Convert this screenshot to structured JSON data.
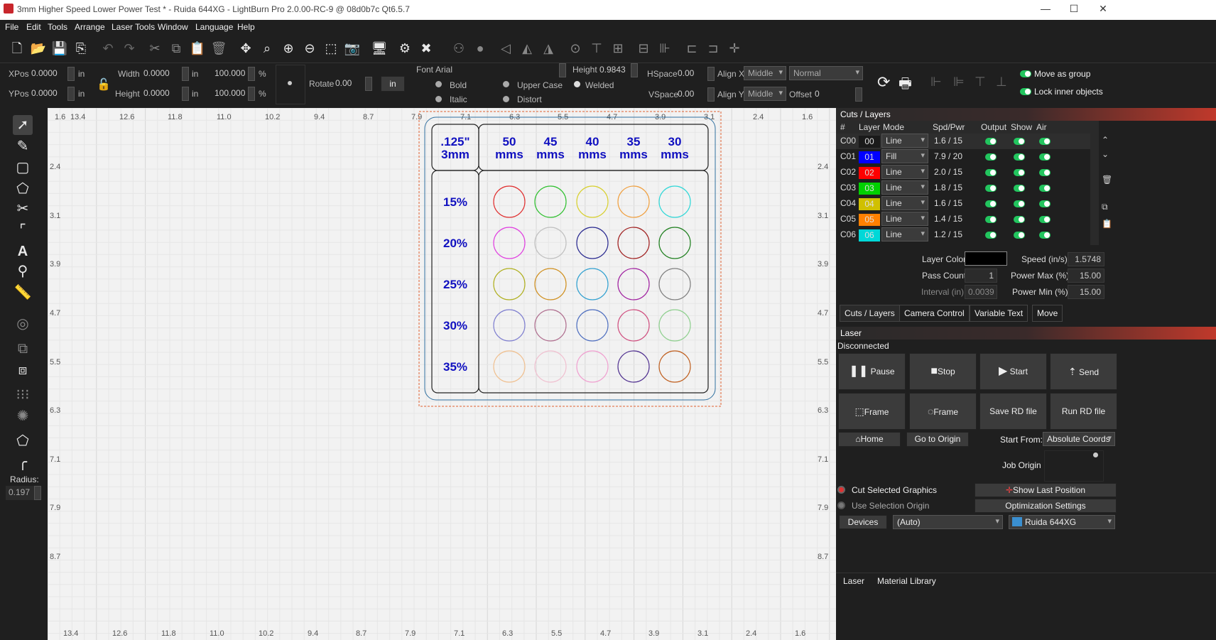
{
  "title": "3mm Higher Speed Lower Power Test * - Ruida 644XG - LightBurn Pro 2.0.00-RC-9 @ 08d0b7c Qt6.5.7",
  "menu": [
    "File",
    "Edit",
    "Tools",
    "Arrange",
    "Laser Tools",
    "Window",
    "Language",
    "Help"
  ],
  "props": {
    "xpos_label": "XPos",
    "xpos": "0.0000",
    "ypos_label": "YPos",
    "ypos": "0.0000",
    "unit_in": "in",
    "width_label": "Width",
    "width": "0.0000",
    "height_label": "Height",
    "height": "0.0000",
    "pct_w": "100.000",
    "pct_h": "100.000",
    "pct": "%",
    "rotate_label": "Rotate",
    "rotate": "0.00",
    "in_btn": "in",
    "font_label": "Font",
    "font": "Arial",
    "height_label2": "Height",
    "font_height": "0.9843",
    "hspace_label": "HSpace",
    "hspace": "0.00",
    "vspace_label": "VSpace",
    "vspace": "0.00",
    "alignx_label": "Align X",
    "alignx": "Middle",
    "aligny_label": "Align Y",
    "aligny": "Middle",
    "normal": "Normal",
    "offset_label": "Offset",
    "offset": "0",
    "bold": "Bold",
    "italic": "Italic",
    "upper_case": "Upper Case",
    "distort": "Distort",
    "welded": "Welded",
    "move_as_group": "Move as group",
    "lock_inner": "Lock inner objects"
  },
  "left": {
    "radius_label": "Radius:",
    "radius": "0.197"
  },
  "ruler": {
    "top": [
      "1.6",
      "13.4",
      "12.6",
      "11.8",
      "11.0",
      "10.2",
      "9.4",
      "8.7",
      "7.9",
      "7.1",
      "6.3",
      "5.5",
      "4.7",
      "3.9",
      "3.1",
      "2.4",
      "1.6"
    ],
    "bottom": [
      "13.4",
      "12.6",
      "11.8",
      "11.0",
      "10.2",
      "9.4",
      "8.7",
      "7.9",
      "7.1",
      "6.3",
      "5.5",
      "4.7",
      "3.9",
      "3.1",
      "2.4",
      "1.6"
    ],
    "left": [
      "2.4",
      "3.1",
      "3.9",
      "4.7",
      "5.5",
      "6.3",
      "7.1",
      "7.9",
      "8.7"
    ],
    "right": [
      "2.4",
      "3.1",
      "3.9",
      "4.7",
      "5.5",
      "6.3",
      "7.1",
      "7.9",
      "8.7"
    ]
  },
  "design": {
    "corner": [
      ".125\"",
      "3mm"
    ],
    "speeds": [
      [
        "50",
        "mms"
      ],
      [
        "45",
        "mms"
      ],
      [
        "40",
        "mms"
      ],
      [
        "35",
        "mms"
      ],
      [
        "30",
        "mms"
      ]
    ],
    "powers": [
      "15%",
      "20%",
      "25%",
      "30%",
      "35%"
    ],
    "circle_colors": [
      [
        "#e03030",
        "#30c030",
        "#d8d030",
        "#f0a040",
        "#30d8d8"
      ],
      [
        "#e040e0",
        "#c0c0c0",
        "#2a2a90",
        "#a02020",
        "#208020"
      ],
      [
        "#b0b020",
        "#d09020",
        "#30a0d0",
        "#a020a0",
        "#808080"
      ],
      [
        "#8080d0",
        "#b07090",
        "#5070c0",
        "#d05080",
        "#90d090"
      ],
      [
        "#f0c090",
        "#f0c0d0",
        "#f0a0d0",
        "#503090",
        "#c06020"
      ]
    ]
  },
  "cuts": {
    "panel_title": "Cuts / Layers",
    "headers": [
      "#",
      "Layer",
      "Mode",
      "Spd/Pwr",
      "Output",
      "Show",
      "Air"
    ],
    "rows": [
      {
        "id": "C00",
        "layer": "00",
        "color": "#1a1a1a",
        "mode": "Line",
        "spd": "1.6 / 15"
      },
      {
        "id": "C01",
        "layer": "01",
        "color": "#0000ff",
        "mode": "Fill",
        "spd": "7.9 / 20"
      },
      {
        "id": "C02",
        "layer": "02",
        "color": "#ff0000",
        "mode": "Line",
        "spd": "2.0 / 15"
      },
      {
        "id": "C03",
        "layer": "03",
        "color": "#00d000",
        "mode": "Line",
        "spd": "1.8 / 15"
      },
      {
        "id": "C04",
        "layer": "04",
        "color": "#d0c000",
        "mode": "Line",
        "spd": "1.6 / 15"
      },
      {
        "id": "C05",
        "layer": "05",
        "color": "#ff8000",
        "mode": "Line",
        "spd": "1.4 / 15"
      },
      {
        "id": "C06",
        "layer": "06",
        "color": "#00d8d8",
        "mode": "Line",
        "spd": "1.2 / 15"
      }
    ],
    "layer_color": "Layer Color",
    "speed_label": "Speed (in/s)",
    "speed": "1.5748",
    "pass_label": "Pass Count",
    "pass": "1",
    "pmax_label": "Power Max (%)",
    "pmax": "15.00",
    "interval_label": "Interval (in)",
    "interval": "0.0039",
    "pmin_label": "Power Min (%)",
    "pmin": "15.00",
    "tabs": [
      "Cuts / Layers",
      "Camera Control",
      "Variable Text",
      "Move"
    ]
  },
  "laser": {
    "panel_title": "Laser",
    "status": "Disconnected",
    "pause": "Pause",
    "stop": "Stop",
    "start": "Start",
    "send": "Send",
    "frame1": "Frame",
    "frame2": "Frame",
    "save_rd": "Save RD file",
    "run_rd": "Run RD file",
    "home": "Home",
    "go_origin": "Go to Origin",
    "start_from_label": "Start From:",
    "start_from": "Absolute Coords",
    "job_origin": "Job Origin",
    "cut_selected": "Cut Selected Graphics",
    "use_sel_origin": "Use Selection Origin",
    "show_last": "Show Last Position",
    "opt_settings": "Optimization Settings",
    "devices": "Devices",
    "auto": "(Auto)",
    "device": "Ruida 644XG",
    "bottom_tabs": [
      "Laser",
      "Material Library"
    ]
  },
  "colors": {
    "accent_red": "#c0392b",
    "toggle_green": "#22c55e",
    "design_blue": "#1010c0"
  }
}
